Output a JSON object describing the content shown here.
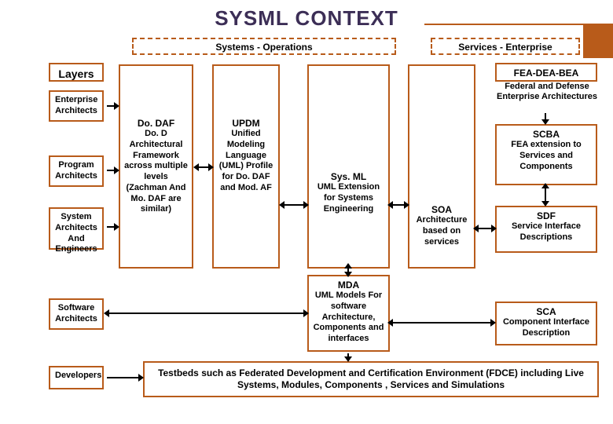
{
  "title": "SYSML CONTEXT",
  "top": {
    "systems_ops": "Systems - Operations",
    "services_ent": "Services - Enterprise"
  },
  "layers_label": "Layers",
  "fea": {
    "title": "FEA-DEA-BEA",
    "sub": "Federal and Defense Enterprise Architectures"
  },
  "left": {
    "ea": "Enterprise Architects",
    "pa": "Program Architects",
    "sae": "System Architects And Engineers",
    "sa": "Software Architects",
    "dev": "Developers"
  },
  "dodaf": {
    "title": "Do. DAF",
    "text": "Do. D Architectural Framework across multiple levels (Zachman And Mo. DAF are similar)"
  },
  "updm": {
    "title": "UPDM",
    "text": "Unified Modeling Language (UML) Profile for Do. DAF and Mod. AF"
  },
  "sysml": {
    "title": "Sys. ML",
    "text": "UML Extension for Systems Engineering"
  },
  "soa": {
    "title": "SOA",
    "text": "Architecture based on services"
  },
  "scba": {
    "title": "SCBA",
    "text": "FEA extension to Services and Components"
  },
  "sdf": {
    "title": "SDF",
    "text": "Service Interface Descriptions"
  },
  "mda": {
    "title": "MDA",
    "text": "UML Models For software Architecture, Components and interfaces"
  },
  "sca": {
    "title": "SCA",
    "text": "Component Interface Description"
  },
  "testbed": "Testbeds such as Federated Development and Certification Environment (FDCE) including Live Systems, Modules, Components , Services and Simulations"
}
